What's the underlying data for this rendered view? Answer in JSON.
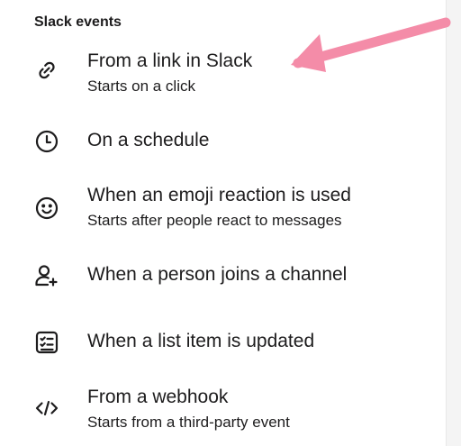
{
  "section": {
    "title": "Slack events"
  },
  "events": [
    {
      "icon": "link-icon",
      "title": "From a link in Slack",
      "subtitle": "Starts on a click"
    },
    {
      "icon": "clock-icon",
      "title": "On a schedule",
      "subtitle": ""
    },
    {
      "icon": "emoji-icon",
      "title": "When an emoji reaction is used",
      "subtitle": "Starts after people react to messages"
    },
    {
      "icon": "add-person-icon",
      "title": "When a person joins a channel",
      "subtitle": ""
    },
    {
      "icon": "list-icon",
      "title": "When a list item is updated",
      "subtitle": ""
    },
    {
      "icon": "code-icon",
      "title": "From a webhook",
      "subtitle": "Starts from a third-party event"
    }
  ],
  "annotation": {
    "arrow_color": "#f48ca8"
  }
}
